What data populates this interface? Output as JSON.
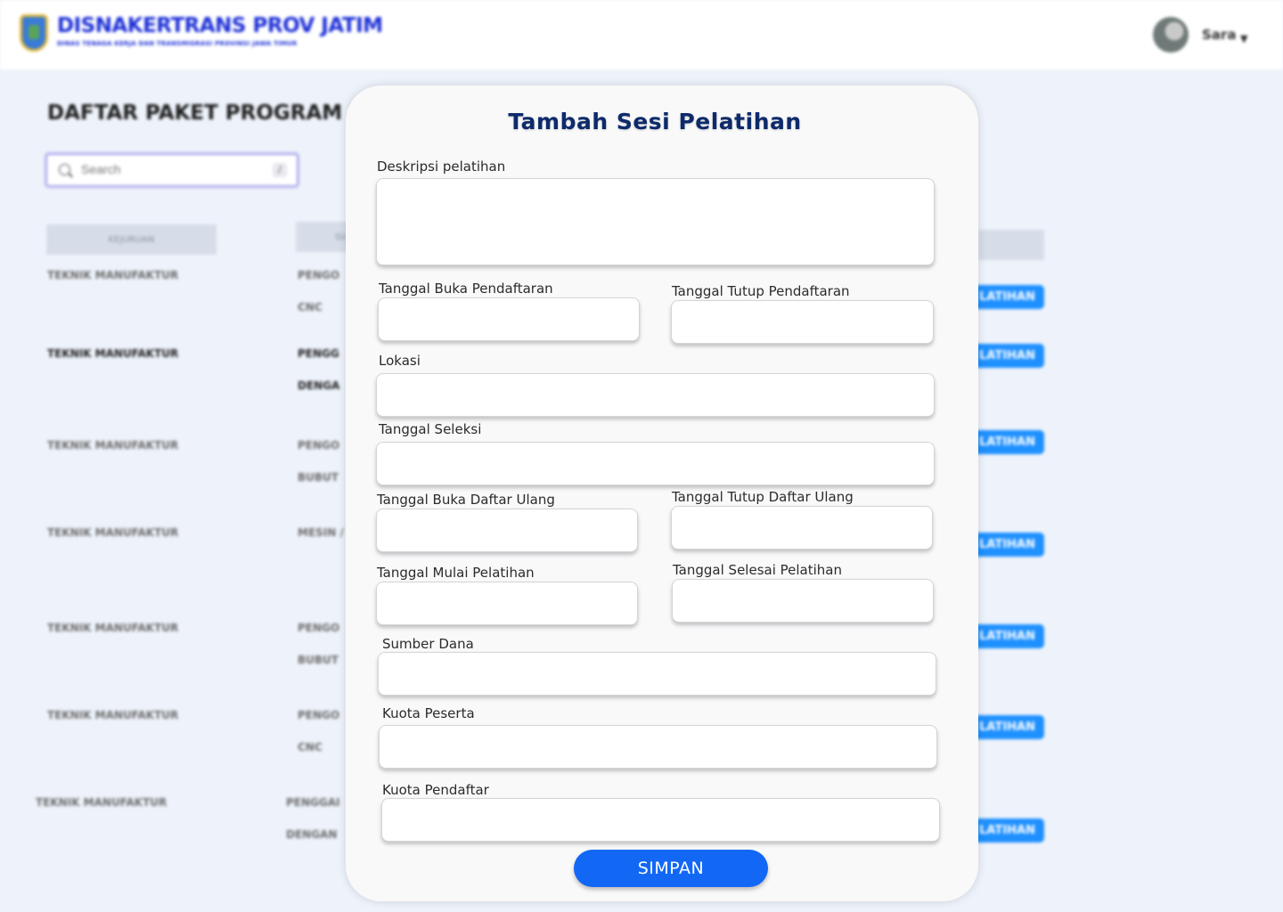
{
  "header": {
    "logo_title": "DISNAKERTRANS PROV JATIM",
    "logo_subtitle": "DINAS TENAGA KERJA DAN TRANSMIGRASI PROVINSI JAWA TIMUR",
    "user_name": "Sara",
    "user_menu_icon": "caret-down-icon"
  },
  "page": {
    "title": "DAFTAR PAKET PROGRAM P",
    "search": {
      "placeholder": "Search",
      "shortcut": "/"
    },
    "table": {
      "columns": [
        "KEJURUAN",
        "SU",
        ""
      ],
      "rows": [
        {
          "kejuruan": "TEKNIK MANUFAKTUR",
          "program_line1": "PENGO",
          "program_line2": "CNC",
          "action": "LATIHAN",
          "bold": false
        },
        {
          "kejuruan": "TEKNIK MANUFAKTUR",
          "program_line1": "PENGG",
          "program_line2": "DENGA",
          "action": "LATIHAN",
          "bold": true
        },
        {
          "kejuruan": "TEKNIK MANUFAKTUR",
          "program_line1": "PENGO",
          "program_line2": "BUBUT",
          "action": "LATIHAN",
          "bold": false
        },
        {
          "kejuruan": "TEKNIK MANUFAKTUR",
          "program_line1": "MESIN /",
          "program_line2": "",
          "action": "LATIHAN",
          "bold": false
        },
        {
          "kejuruan": "TEKNIK MANUFAKTUR",
          "program_line1": "PENGO",
          "program_line2": "BUBUT",
          "action": "LATIHAN",
          "bold": false
        },
        {
          "kejuruan": "TEKNIK MANUFAKTUR",
          "program_line1": "PENGO",
          "program_line2": "CNC",
          "action": "LATIHAN",
          "bold": false
        },
        {
          "kejuruan": "TEKNIK MANUFAKTUR",
          "program_line1": "PENGGAI",
          "program_line2": "DENGAN",
          "action": "LATIHAN",
          "bold": false
        }
      ]
    }
  },
  "modal": {
    "title": "Tambah Sesi Pelatihan",
    "fields": {
      "deskripsi": {
        "label": "Deskripsi pelatihan",
        "value": ""
      },
      "tgl_buka_pendaftaran": {
        "label": "Tanggal Buka Pendaftaran",
        "value": ""
      },
      "tgl_tutup_pendaftaran": {
        "label": "Tanggal Tutup Pendaftaran",
        "value": ""
      },
      "lokasi": {
        "label": "Lokasi",
        "value": ""
      },
      "tgl_seleksi": {
        "label": "Tanggal Seleksi",
        "value": ""
      },
      "tgl_buka_daftar_ulang": {
        "label": "Tanggal Buka Daftar Ulang",
        "value": ""
      },
      "tgl_tutup_daftar_ulang": {
        "label": "Tanggal Tutup Daftar Ulang",
        "value": ""
      },
      "tgl_mulai_pelatihan": {
        "label": "Tanggal Mulai Pelatihan",
        "value": ""
      },
      "tgl_selesai_pelatihan": {
        "label": "Tanggal Selesai Pelatihan",
        "value": ""
      },
      "sumber_dana": {
        "label": "Sumber Dana",
        "value": ""
      },
      "kuota_peserta": {
        "label": "Kuota Peserta",
        "value": ""
      },
      "kuota_pendaftar": {
        "label": "Kuota Pendaftar",
        "value": ""
      }
    },
    "submit_label": "SIMPAN"
  },
  "colors": {
    "brand_blue": "#1c2fd6",
    "modal_title": "#0d2a6b",
    "primary_button": "#1268f5",
    "action_pill": "#1e90ff",
    "page_background": "#eef3fb"
  }
}
